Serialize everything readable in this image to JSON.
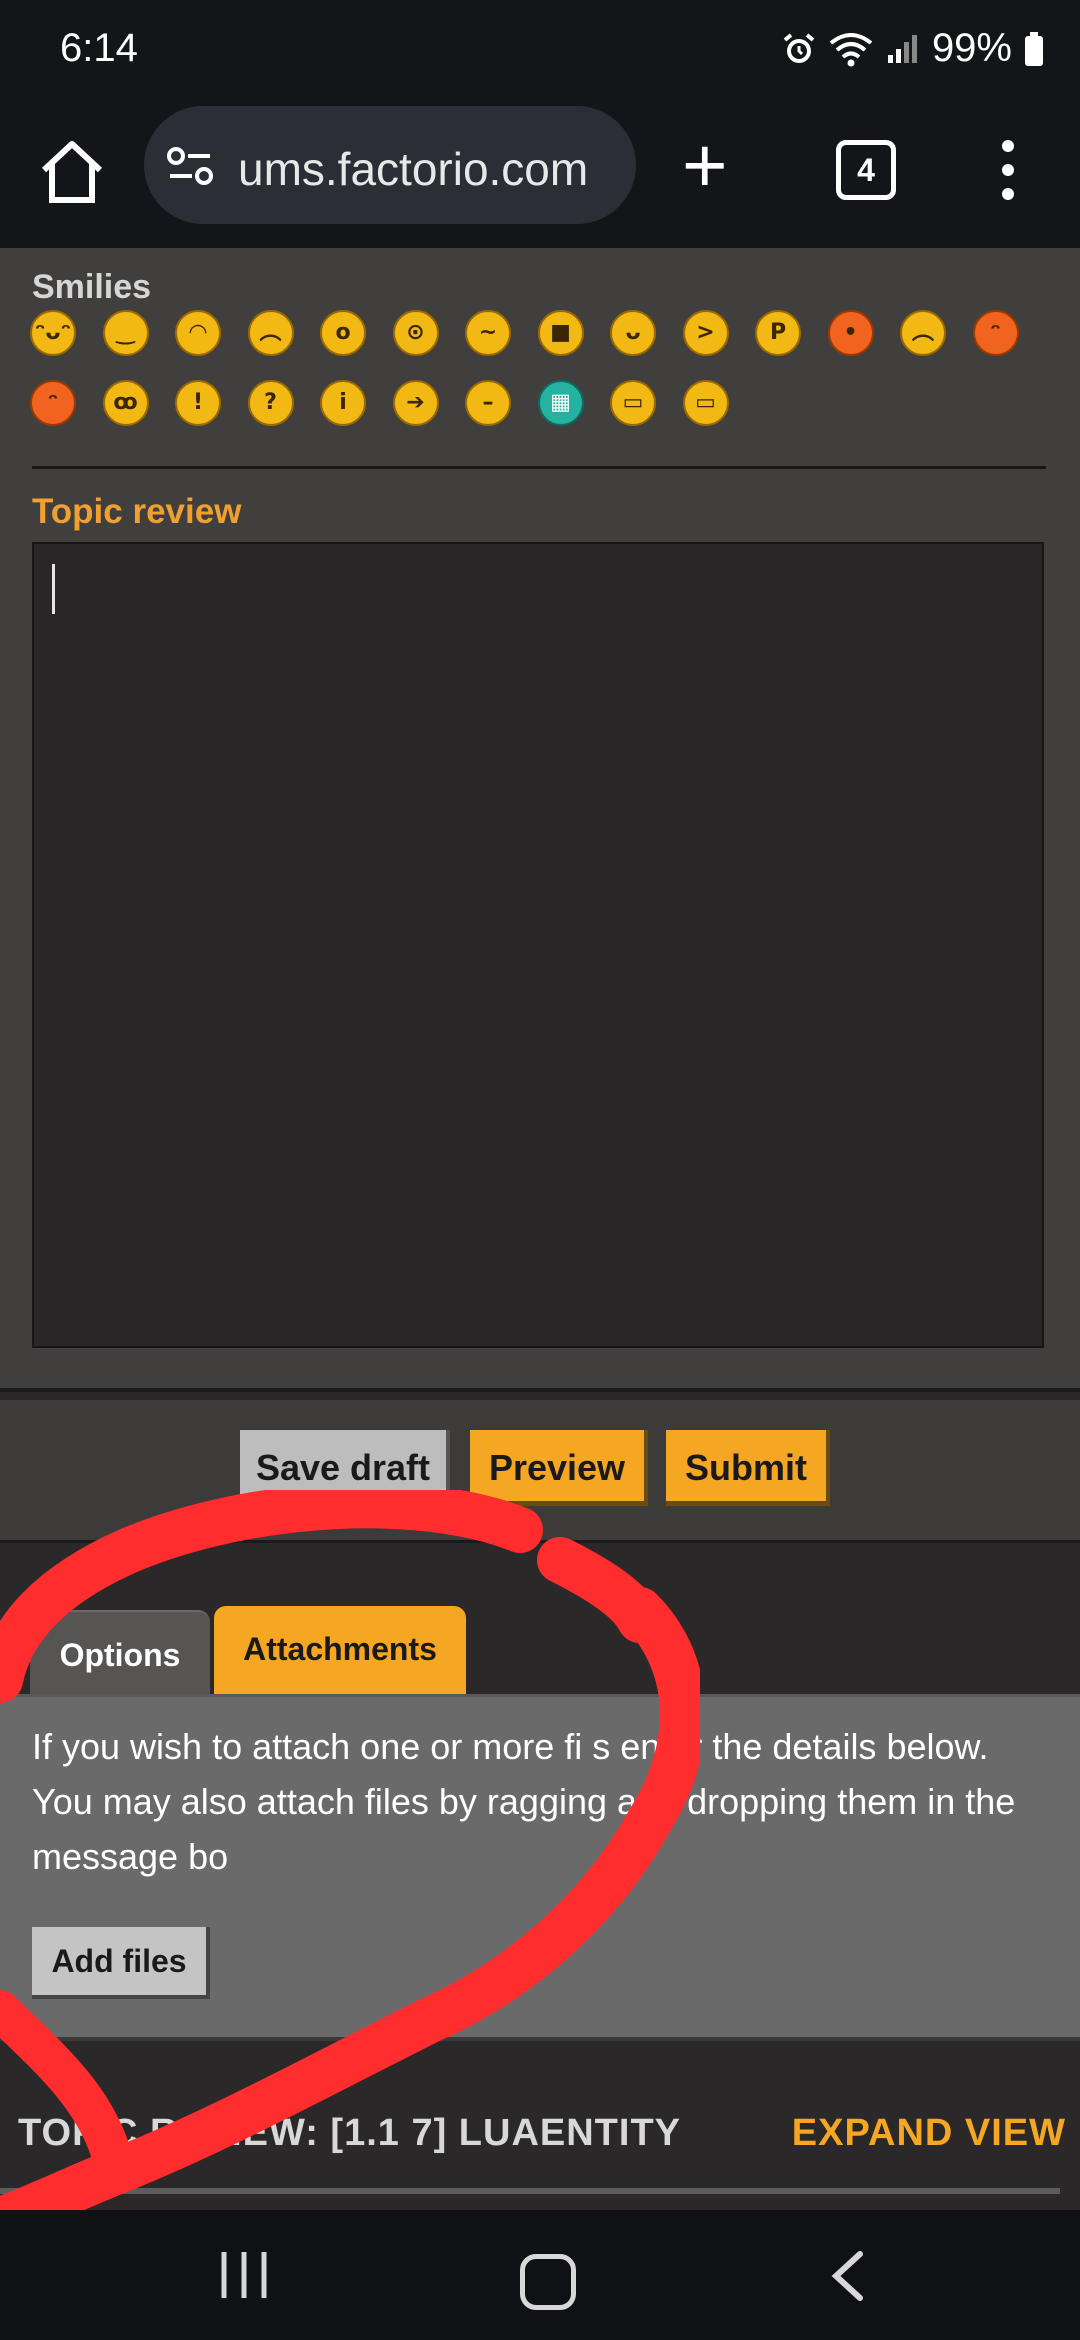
{
  "status_bar": {
    "time": "6:14",
    "battery": "99%"
  },
  "browser": {
    "url": "ums.factorio.com",
    "tab_count": "4"
  },
  "editor": {
    "smilies_label": "Smilies",
    "smilies": [
      {
        "glyph": "ᵔᴗᵔ",
        "style": "yellow"
      },
      {
        "glyph": "‿",
        "style": "yellow"
      },
      {
        "glyph": "◠",
        "style": "yellow"
      },
      {
        "glyph": "︵",
        "style": "yellow"
      },
      {
        "glyph": "o",
        "style": "yellow"
      },
      {
        "glyph": "⊙",
        "style": "yellow"
      },
      {
        "glyph": "~",
        "style": "yellow"
      },
      {
        "glyph": "■",
        "style": "yellow"
      },
      {
        "glyph": "ᴗ",
        "style": "yellow"
      },
      {
        "glyph": ">",
        "style": "yellow"
      },
      {
        "glyph": "P",
        "style": "yellow"
      },
      {
        "glyph": "•",
        "style": "red"
      },
      {
        "glyph": "︵",
        "style": "yellow"
      },
      {
        "glyph": "ᵔ",
        "style": "red"
      },
      {
        "glyph": "ᵔ",
        "style": "red"
      },
      {
        "glyph": "ꝏ",
        "style": "yellow"
      },
      {
        "glyph": "!",
        "style": "yellow"
      },
      {
        "glyph": "?",
        "style": "yellow"
      },
      {
        "glyph": "i",
        "style": "yellow"
      },
      {
        "glyph": "➔",
        "style": "yellow"
      },
      {
        "glyph": "–",
        "style": "yellow"
      },
      {
        "glyph": "▦",
        "style": "teal"
      },
      {
        "glyph": "▭",
        "style": "yellow"
      },
      {
        "glyph": "▭",
        "style": "yellow"
      }
    ],
    "topic_review_label": "Topic review"
  },
  "actions": {
    "save_draft": "Save draft",
    "preview": "Preview",
    "submit": "Submit"
  },
  "tabs": {
    "options": "Options",
    "attachments": "Attachments"
  },
  "attachments_panel": {
    "text": "If you wish to attach one or more fi s enter the details below. You may also attach files by ragging and dropping them in the message bo",
    "add_files": "Add files"
  },
  "topic_review_section": {
    "title": "TOPIC REVIEW: [1.1 7] LUAENTITY",
    "expand_view": "EXPAND VIEW"
  },
  "colors": {
    "accent": "#f5a623",
    "annotation": "#ff2d2d"
  },
  "icons": {
    "status": [
      "alarm-icon",
      "wifi-icon",
      "signal-icon",
      "battery-icon"
    ],
    "toolbar": [
      "home-icon",
      "site-settings-icon",
      "new-tab-icon",
      "tab-switcher-icon",
      "menu-icon"
    ],
    "navbar": [
      "recents-icon",
      "home-circle-icon",
      "back-icon"
    ]
  }
}
